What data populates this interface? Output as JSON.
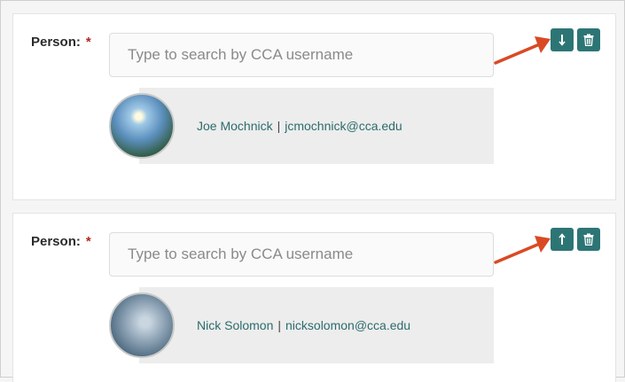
{
  "entries": [
    {
      "label": "Person:",
      "required_mark": "*",
      "search_placeholder": "Type to search by CCA username",
      "person_name": "Joe Mochnick",
      "separator": "|",
      "person_email": "jcmochnick@cca.edu",
      "move_icon": "arrow-down-icon",
      "delete_icon": "trash-icon"
    },
    {
      "label": "Person:",
      "required_mark": "*",
      "search_placeholder": "Type to search by CCA username",
      "person_name": "Nick Solomon",
      "separator": "|",
      "person_email": "nicksolomon@cca.edu",
      "move_icon": "arrow-up-icon",
      "delete_icon": "trash-icon"
    }
  ],
  "colors": {
    "button": "#2d7575",
    "annotation_arrow": "#d94a24",
    "link_text": "#2d6b6e",
    "required": "#b3261e"
  }
}
